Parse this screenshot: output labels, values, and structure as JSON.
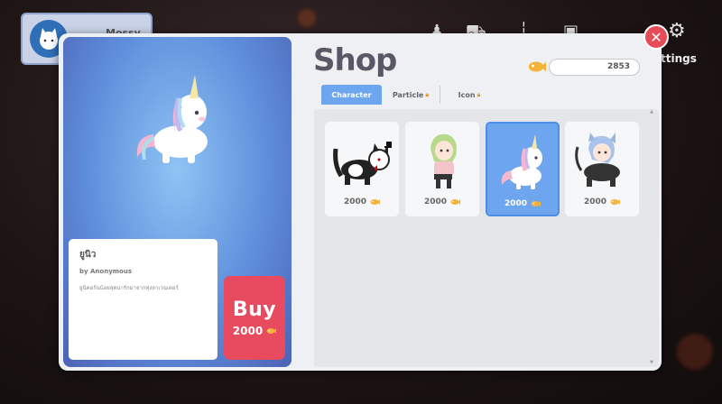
{
  "background": {
    "profile": {
      "username": "Mossy Boy"
    },
    "settings_label": "ttings"
  },
  "preview": {
    "name": "ยูนิว",
    "author": "by Anonymous",
    "description": "ยูนิคอร์นน้อยสุดน่ารักมาจากทุ่งลาเวนเดอร์",
    "buy_label": "Buy",
    "buy_price": "2000"
  },
  "shop": {
    "title": "Shop",
    "balance": "2853",
    "tabs": [
      {
        "label": "Character",
        "locked": false,
        "active": true
      },
      {
        "label": "Particle",
        "locked": true,
        "active": false
      },
      {
        "label": "Icon",
        "locked": true,
        "active": false
      }
    ],
    "items": [
      {
        "name": "tuxedo-cat",
        "price": "2000",
        "selected": false
      },
      {
        "name": "green-hair-girl",
        "price": "2000",
        "selected": false
      },
      {
        "name": "unicorn",
        "price": "2000",
        "selected": true
      },
      {
        "name": "blue-hair-catgirl",
        "price": "2000",
        "selected": false
      }
    ]
  },
  "icons": {
    "close": "close-icon",
    "currency": "fish-coin-icon",
    "lock": "lock-icon"
  },
  "colors": {
    "accent": "#6ea5ef",
    "buy": "#e84a5f",
    "close": "#e64b58"
  }
}
